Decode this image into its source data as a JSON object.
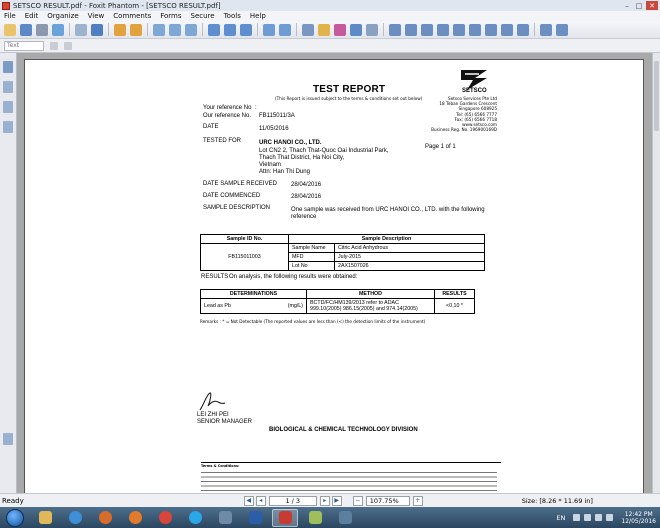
{
  "window": {
    "title": "SETSCO RESULT.pdf - Foxit Phantom - [SETSCO RESULT.pdf]"
  },
  "menu": [
    "File",
    "Edit",
    "Organize",
    "View",
    "Comments",
    "Forms",
    "Secure",
    "Tools",
    "Help"
  ],
  "toolbar2": {
    "font_placeholder": "Text"
  },
  "document": {
    "title": "TEST REPORT",
    "subtitle": "(This Report is issued subject to the terms & conditions set out below)",
    "logo_text": "SETSCO",
    "company_address": [
      "Setsco Services Pte Ltd",
      "18 Teban Gardens Crescent",
      "Singapore 608925",
      "Tel: (65) 6566 7777",
      "Fax: (65) 6566 7718",
      "www.setsco.com",
      "Business Reg. No. 196900169D"
    ],
    "page_info": "Page 1 of 1",
    "your_ref_label": "Your reference No",
    "your_ref_value": ":",
    "our_ref_label": "Our reference No.",
    "our_ref_value": "FB115011/3A",
    "date_label": "DATE",
    "date_value": "11/05/2016",
    "tested_for_label": "TESTED FOR",
    "tested_for_name": "URC HANOI CO., LTD.",
    "tested_for_address": [
      "Lot CN2 2, Thach That-Quoc Oai Industrial Park,",
      "Thach That District, Ha Noi City,",
      "Vietnam"
    ],
    "attn": "Attn: Han Thi Dung",
    "date_received_label": "DATE SAMPLE RECEIVED",
    "date_received_value": "28/04/2016",
    "date_commenced_label": "DATE COMMENCED",
    "date_commenced_value": "28/04/2016",
    "sample_desc_label": "SAMPLE DESCRIPTION",
    "sample_desc_line1": "One sample was received from URC HANOI CO., LTD. with the following",
    "sample_desc_line2": "reference",
    "sample_table": {
      "headers": [
        "Sample ID No.",
        "Sample Description"
      ],
      "sample_id": "FB115011003",
      "rows": [
        [
          "Sample Name",
          "Citric Acid Anhydrous"
        ],
        [
          "MFD",
          "July-2015"
        ],
        [
          "Lot No",
          "2AX1507026"
        ]
      ]
    },
    "results_label": "RESULTS",
    "results_intro": "On analysis, the following results were obtained:",
    "results_table": {
      "headers": [
        "DETERMINATIONS",
        "METHOD",
        "RESULTS"
      ],
      "row": {
        "determination": "Lead as Pb",
        "unit": "(mg/L)",
        "method_line1": "BCTD/FC/HM139/2013 refer to ADAC",
        "method_line2": "999.10(2005) 986.15(2005) and 974.14(2005)",
        "result": "<0.10 *"
      }
    },
    "remarks": "Remarks : * = Not Detectable (The reported values are less than (<) the detection limits of the instrument)",
    "signatory_name": "LEI ZHI PEI",
    "signatory_title": "SENIOR MANAGER",
    "division": "BIOLOGICAL & CHEMICAL TECHNOLOGY DIVISION",
    "terms_heading": "Terms & Conditions:"
  },
  "statusbar": {
    "ready": "Ready",
    "page": "1 / 3",
    "zoom": "107.75%",
    "size": "Size: [8.26 * 11.69 in]"
  },
  "taskbar": {
    "language": "EN",
    "time": "12:42 PM",
    "date": "12/05/2016"
  },
  "colors": {
    "titlebar": "#dfe6ef",
    "taskbar": "#2b4660",
    "page_bg": "#ffffff",
    "workspace": "#a9a9a9"
  }
}
